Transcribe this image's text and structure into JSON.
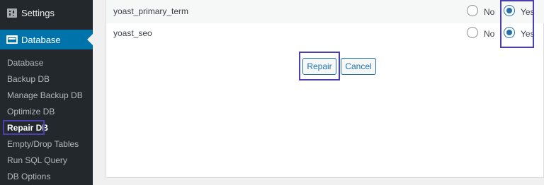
{
  "sidebar": {
    "settings_label": "Settings",
    "active_label": "Database",
    "submenu": [
      {
        "label": "Database"
      },
      {
        "label": "Backup DB"
      },
      {
        "label": "Manage Backup DB"
      },
      {
        "label": "Optimize DB"
      },
      {
        "label": "Repair DB"
      },
      {
        "label": "Empty/Drop Tables"
      },
      {
        "label": "Run SQL Query"
      },
      {
        "label": "DB Options"
      }
    ],
    "current_item": "Repair DB"
  },
  "table": {
    "rows": [
      {
        "name": "yoast_primary_term",
        "no_label": "No",
        "yes_label": "Yes",
        "selected": "Yes"
      },
      {
        "name": "yoast_seo",
        "no_label": "No",
        "yes_label": "Yes",
        "selected": "Yes"
      }
    ]
  },
  "actions": {
    "repair_label": "Repair",
    "cancel_label": "Cancel"
  },
  "colors": {
    "sidebar_bg": "#23282d",
    "active_bg": "#0073aa",
    "highlight": "#4b3fb0",
    "accent": "#2271b1"
  }
}
